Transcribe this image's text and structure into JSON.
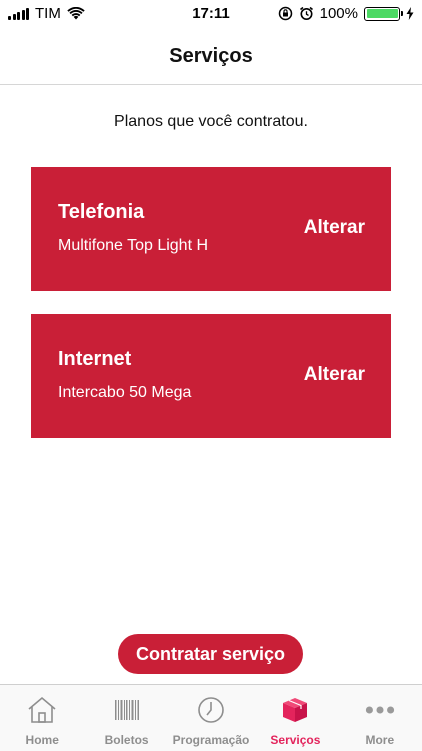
{
  "status_bar": {
    "carrier": "TIM",
    "time": "17:11",
    "battery_percent": "100%",
    "battery_level": 1.0,
    "battery_color": "#4cd964"
  },
  "header": {
    "title": "Serviços"
  },
  "main": {
    "subtitle": "Planos que você contratou.",
    "plans": [
      {
        "name": "Telefonia",
        "description": "Multifone Top Light H",
        "action_label": "Alterar"
      },
      {
        "name": "Internet",
        "description": "Intercabo 50 Mega",
        "action_label": "Alterar"
      }
    ],
    "cta_label": "Contratar serviço"
  },
  "tab_bar": {
    "items": [
      {
        "label": "Home",
        "icon": "house-icon",
        "active": false
      },
      {
        "label": "Boletos",
        "icon": "barcode-icon",
        "active": false
      },
      {
        "label": "Programação",
        "icon": "clock-icon",
        "active": false
      },
      {
        "label": "Serviços",
        "icon": "box-icon",
        "active": true
      },
      {
        "label": "More",
        "icon": "more-icon",
        "active": false
      }
    ]
  },
  "colors": {
    "accent": "#c91f37",
    "tab_active": "#e3245c",
    "tab_inactive": "#8e8e8e"
  }
}
